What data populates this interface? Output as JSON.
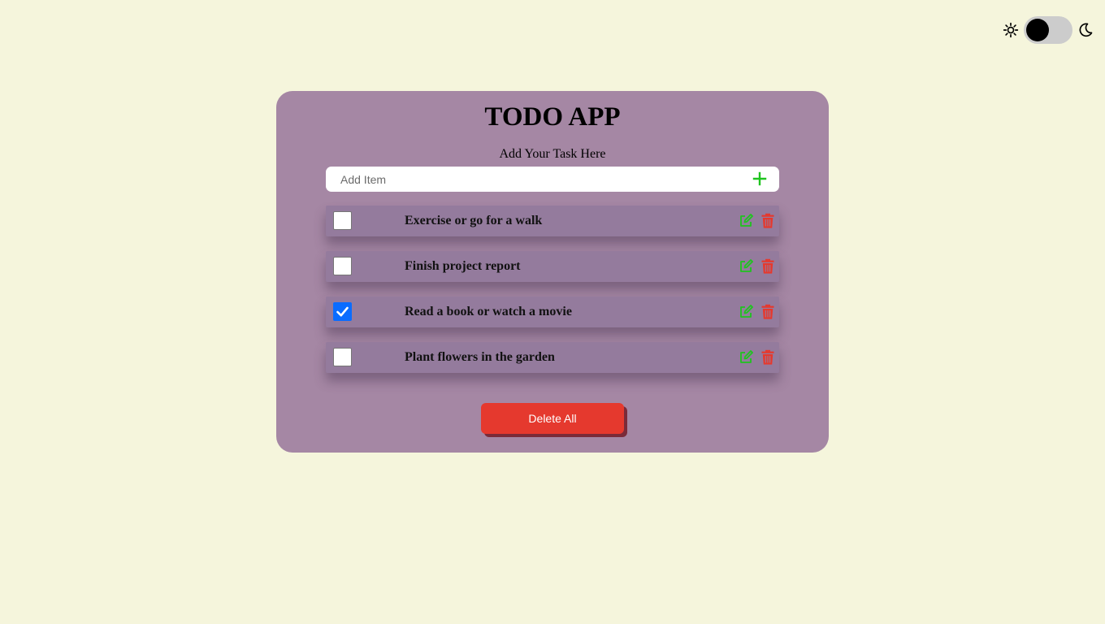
{
  "header": {
    "sun_icon": "sun-icon",
    "moon_icon": "moon-icon",
    "theme_toggle_state": "light"
  },
  "app": {
    "title": "TODO APP",
    "subtitle": "Add Your Task Here",
    "input_placeholder": "Add Item",
    "input_value": "",
    "add_icon": "plus-icon",
    "delete_all_label": "Delete All"
  },
  "tasks": [
    {
      "text": "Exercise or go for a walk",
      "completed": false
    },
    {
      "text": "Finish project report",
      "completed": false
    },
    {
      "text": "Read a book or watch a movie",
      "completed": true
    },
    {
      "text": "Plant flowers in the garden",
      "completed": false
    }
  ],
  "colors": {
    "page_background": "#f5f5dc",
    "card_background": "#a587a4",
    "task_background": "#947b9d",
    "accent_green": "#1fc41f",
    "danger_red": "#e5392e",
    "checkbox_checked": "#0a6cff"
  }
}
